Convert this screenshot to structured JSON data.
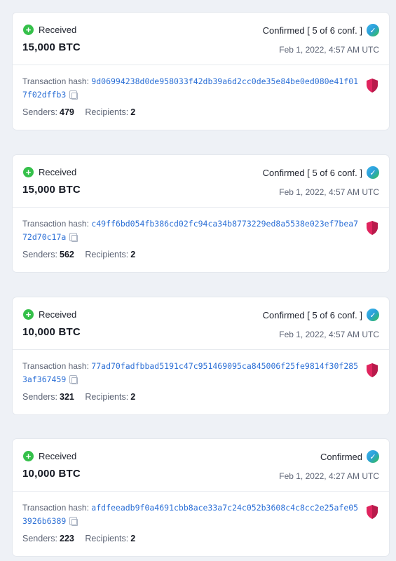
{
  "transactions": [
    {
      "direction": "Received",
      "amount": "15,000 BTC",
      "status": "Confirmed [ 5 of 6 conf. ]",
      "time": "Feb 1, 2022, 4:57 AM UTC",
      "hash_label": "Transaction hash:",
      "hash": "9d06994238d0de958033f42db39a6d2cc0de35e84be0ed080e41f017f02dffb3",
      "senders_label": "Senders:",
      "senders": "479",
      "recipients_label": "Recipients:",
      "recipients": "2"
    },
    {
      "direction": "Received",
      "amount": "15,000 BTC",
      "status": "Confirmed [ 5 of 6 conf. ]",
      "time": "Feb 1, 2022, 4:57 AM UTC",
      "hash_label": "Transaction hash:",
      "hash": "c49ff6bd054fb386cd02fc94ca34b8773229ed8a5538e023ef7bea772d70c17a",
      "senders_label": "Senders:",
      "senders": "562",
      "recipients_label": "Recipients:",
      "recipients": "2"
    },
    {
      "direction": "Received",
      "amount": "10,000 BTC",
      "status": "Confirmed [ 5 of 6 conf. ]",
      "time": "Feb 1, 2022, 4:57 AM UTC",
      "hash_label": "Transaction hash:",
      "hash": "77ad70fadfbbad5191c47c951469095ca845006f25fe9814f30f2853af367459",
      "senders_label": "Senders:",
      "senders": "321",
      "recipients_label": "Recipients:",
      "recipients": "2"
    },
    {
      "direction": "Received",
      "amount": "10,000 BTC",
      "status": "Confirmed",
      "time": "Feb 1, 2022, 4:27 AM UTC",
      "hash_label": "Transaction hash:",
      "hash": "afdfeeadb9f0a4691cbb8ace33a7c24c052b3608c4c8cc2e25afe053926b6389",
      "senders_label": "Senders:",
      "senders": "223",
      "recipients_label": "Recipients:",
      "recipients": "2"
    }
  ],
  "icons": {
    "received": "plus-circle-icon",
    "status": "check-circle-icon",
    "copy": "copy-icon",
    "risk": "shield-icon"
  },
  "colors": {
    "received_green": "#35c04a",
    "hash_blue": "#2b6fd6",
    "shield_pink": "#e0245e"
  }
}
